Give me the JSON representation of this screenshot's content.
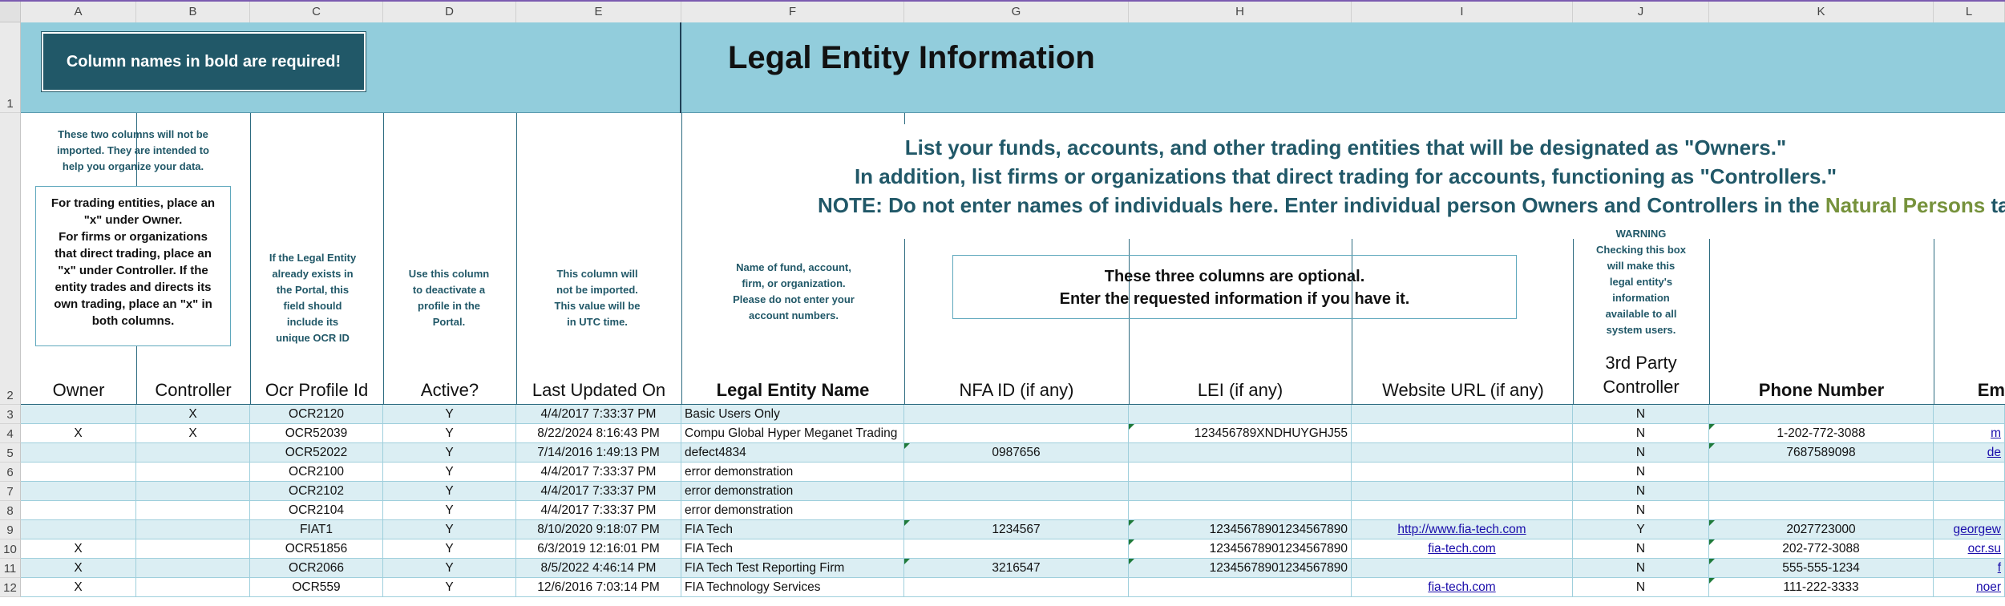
{
  "columns": [
    "A",
    "B",
    "C",
    "D",
    "E",
    "F",
    "G",
    "H",
    "I",
    "J",
    "K",
    "L"
  ],
  "row_numbers": [
    "1",
    "2",
    "3",
    "4",
    "5",
    "6",
    "7",
    "8",
    "9",
    "10",
    "11",
    "12"
  ],
  "banner": {
    "required_note": "Column names in bold are required!",
    "title": "Legal Entity Information"
  },
  "notes": {
    "ab_top": [
      "These two columns  will not be",
      "imported. They are intended to",
      "help you organize your data."
    ],
    "ab_box": [
      "For trading entities, place an",
      "\"x\" under Owner.",
      "For firms or organizations",
      "that direct trading, place an",
      "\"x\" under Controller. If the",
      "entity trades and directs its",
      "own trading, place an \"x\" in",
      "both columns."
    ],
    "c_note": [
      "If the Legal Entity",
      "already exists in",
      "the Portal, this",
      "field should",
      "include its",
      "unique OCR ID"
    ],
    "d_note": [
      "Use this column",
      "to deactivate a",
      "profile in the",
      "Portal."
    ],
    "e_note": [
      "This column will",
      "not be imported.",
      "This value will be",
      "in UTC time."
    ],
    "f_note": [
      "Name of fund,  account,",
      "firm, or  organization.",
      "Please do not enter your",
      "account numbers."
    ],
    "big": [
      "List your funds, accounts, and other trading entities that will be designated as \"Owners.\"",
      "In addition, list  firms or organizations that direct  trading for accounts, functioning as \"Controllers.\""
    ],
    "big3_prefix": "NOTE: Do not enter names of individuals here. Enter individual person Owners and Controllers in the ",
    "big3_green": "Natural Persons",
    "big3_suffix": " tab",
    "optional": [
      "These three columns are optional.",
      "Enter the requested information if you have it."
    ],
    "warning": [
      "WARNING",
      "Checking this box",
      "will make this",
      "legal entity's",
      "information",
      "available to all",
      "system users."
    ]
  },
  "headers": {
    "owner": "Owner",
    "controller": "Controller",
    "ocr_profile_id": "Ocr Profile Id",
    "active": "Active?",
    "last_updated": "Last Updated On",
    "legal_entity_name": "Legal Entity Name",
    "nfa_id": "NFA ID (if any)",
    "lei": "LEI (if any)",
    "website": "Website URL (if any)",
    "third_party": [
      "3rd Party",
      "Controller"
    ],
    "phone": "Phone Number",
    "email": "Em"
  },
  "rows": [
    {
      "owner": "",
      "controller": "X",
      "ocr": "OCR2120",
      "active": "Y",
      "updated": "4/4/2017 7:33:37 PM",
      "name": "Basic Users Only",
      "nfa": "",
      "lei": "",
      "web": "",
      "third": "N",
      "phone": "",
      "email": ""
    },
    {
      "owner": "X",
      "controller": "X",
      "ocr": "OCR52039",
      "active": "Y",
      "updated": "8/22/2024 8:16:43 PM",
      "name": "Compu Global Hyper Meganet Trading",
      "nfa": "",
      "lei": "123456789XNDHUYGHJ55",
      "web": "",
      "third": "N",
      "phone": "1-202-772-3088",
      "email": "m"
    },
    {
      "owner": "",
      "controller": "",
      "ocr": "OCR52022",
      "active": "Y",
      "updated": "7/14/2016 1:49:13 PM",
      "name": "defect4834",
      "nfa": "0987656",
      "lei": "",
      "web": "",
      "third": "N",
      "phone": "7687589098",
      "email": "de"
    },
    {
      "owner": "",
      "controller": "",
      "ocr": "OCR2100",
      "active": "Y",
      "updated": "4/4/2017 7:33:37 PM",
      "name": "error demonstration",
      "nfa": "",
      "lei": "",
      "web": "",
      "third": "N",
      "phone": "",
      "email": ""
    },
    {
      "owner": "",
      "controller": "",
      "ocr": "OCR2102",
      "active": "Y",
      "updated": "4/4/2017 7:33:37 PM",
      "name": "error demonstration",
      "nfa": "",
      "lei": "",
      "web": "",
      "third": "N",
      "phone": "",
      "email": ""
    },
    {
      "owner": "",
      "controller": "",
      "ocr": "OCR2104",
      "active": "Y",
      "updated": "4/4/2017 7:33:37 PM",
      "name": "error demonstration",
      "nfa": "",
      "lei": "",
      "web": "",
      "third": "N",
      "phone": "",
      "email": ""
    },
    {
      "owner": "",
      "controller": "",
      "ocr": "FIAT1",
      "active": "Y",
      "updated": "8/10/2020 9:18:07 PM",
      "name": "FIA Tech",
      "nfa": "1234567",
      "lei": "12345678901234567890",
      "web": "http://www.fia-tech.com",
      "third": "Y",
      "phone": "2027723000",
      "email": "georgew"
    },
    {
      "owner": "X",
      "controller": "",
      "ocr": "OCR51856",
      "active": "Y",
      "updated": "6/3/2019 12:16:01 PM",
      "name": "FIA Tech",
      "nfa": "",
      "lei": "12345678901234567890",
      "web": "fia-tech.com",
      "third": "N",
      "phone": "202-772-3088",
      "email": "ocr.su"
    },
    {
      "owner": "X",
      "controller": "",
      "ocr": "OCR2066",
      "active": "Y",
      "updated": "8/5/2022 4:46:14 PM",
      "name": "FIA Tech Test Reporting Firm",
      "nfa": "3216547",
      "lei": "12345678901234567890",
      "web": "",
      "third": "N",
      "phone": "555-555-1234",
      "email": "f"
    },
    {
      "owner": "X",
      "controller": "",
      "ocr": "OCR559",
      "active": "Y",
      "updated": "12/6/2016 7:03:14 PM",
      "name": "FIA Technology Services",
      "nfa": "",
      "lei": "",
      "web": "fia-tech.com",
      "third": "N",
      "phone": "111-222-3333",
      "email": "noer"
    }
  ]
}
